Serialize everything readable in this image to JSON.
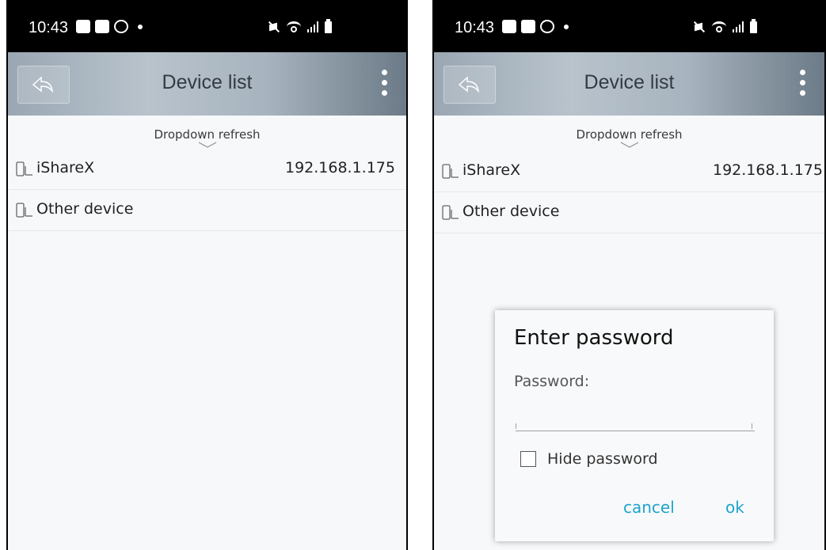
{
  "status_bar": {
    "time": "10:43"
  },
  "app_bar": {
    "title": "Device list"
  },
  "content": {
    "refresh_hint": "Dropdown refresh",
    "devices": [
      {
        "name": "iShareX",
        "ip": "192.168.1.175"
      },
      {
        "name": "Other device",
        "ip": ""
      }
    ]
  },
  "dialog": {
    "title": "Enter password",
    "password_label": "Password:",
    "password_value": "",
    "hide_password_label": "Hide password",
    "hide_password_checked": false,
    "cancel_label": "cancel",
    "ok_label": "ok"
  },
  "colors": {
    "accent": "#1ea4c9",
    "app_bar": "#a7b3be",
    "background": "#f7f8fa"
  }
}
